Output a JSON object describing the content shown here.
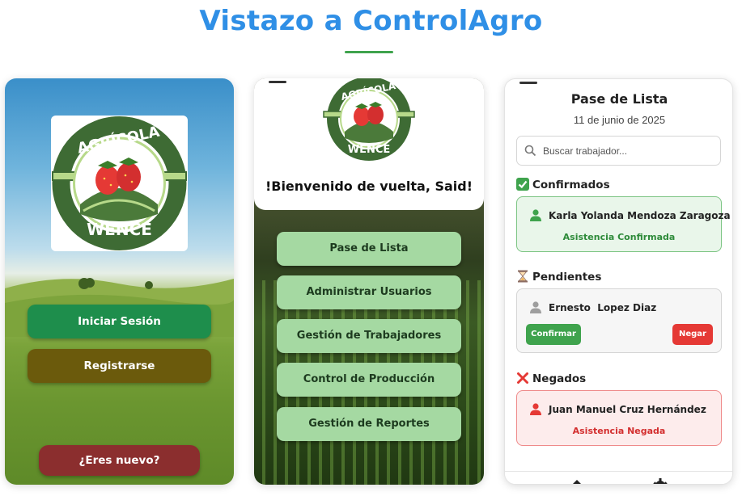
{
  "title": "Vistazo a ControlAgro",
  "login": {
    "logo_top": "AGRÍCOLA",
    "logo_bottom": "WENCE",
    "login_button": "Iniciar Sesión",
    "register_button": "Registrarse",
    "new_button": "¿Eres nuevo?"
  },
  "menu": {
    "logo_top": "AGRÍCOLA",
    "logo_bottom": "WENCE",
    "welcome": "!Bienvenido de vuelta, Said!",
    "items": [
      "Pase de Lista",
      "Administrar Usuarios",
      "Gestión de Trabajadores",
      "Control de Producción",
      "Gestión de Reportes"
    ]
  },
  "attendance": {
    "title": "Pase de Lista",
    "date": "11 de junio de 2025",
    "search_placeholder": "Buscar trabajador...",
    "confirmed": {
      "heading": "Confirmados",
      "name": "Karla Yolanda Mendoza Zaragoza",
      "status": "Asistencia Confirmada"
    },
    "pending": {
      "heading": "Pendientes",
      "name": "Ernesto  Lopez Diaz",
      "confirm_button": "Confirmar",
      "deny_button": "Negar"
    },
    "denied": {
      "heading": "Negados",
      "name": "Juan Manuel Cruz Hernández",
      "status": "Asistencia Negada"
    }
  },
  "colors": {
    "title_blue": "#2f8fe6",
    "login_green": "#1e8e4c",
    "register_brown": "#6b5a0c",
    "new_red": "#8b2e2e",
    "menu_button": "#a5d9a2",
    "confirm_green": "#3fa34d",
    "deny_red": "#e53935"
  }
}
